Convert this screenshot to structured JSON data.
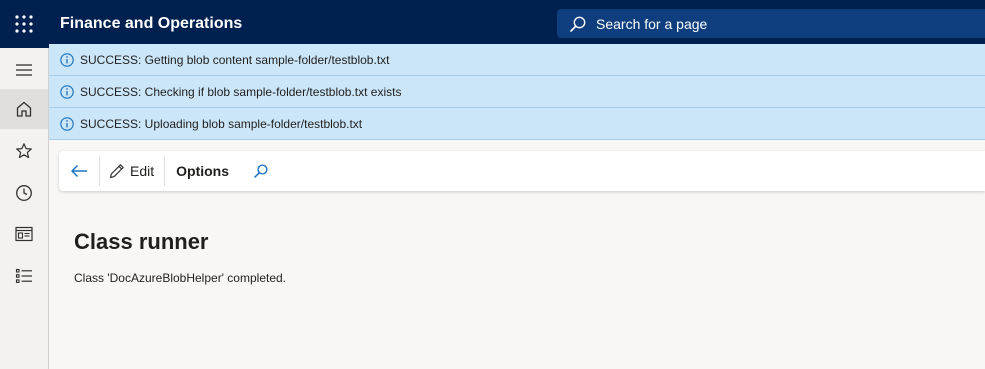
{
  "app": {
    "title": "Finance and Operations"
  },
  "search": {
    "placeholder": "Search for a page"
  },
  "nav": {
    "items": [
      {
        "name": "menu",
        "icon": "hamburger-icon"
      },
      {
        "name": "home",
        "icon": "home-icon"
      },
      {
        "name": "favorites",
        "icon": "star-icon"
      },
      {
        "name": "recent",
        "icon": "clock-icon"
      },
      {
        "name": "workspaces",
        "icon": "workspace-icon"
      },
      {
        "name": "modules",
        "icon": "list-icon"
      }
    ]
  },
  "messages": [
    {
      "text": "SUCCESS: Getting blob content sample-folder/testblob.txt",
      "icon": "info-icon"
    },
    {
      "text": "SUCCESS: Checking if blob sample-folder/testblob.txt exists",
      "icon": "info-icon"
    },
    {
      "text": "SUCCESS: Uploading blob sample-folder/testblob.txt",
      "icon": "info-icon"
    }
  ],
  "actionpane": {
    "edit_label": "Edit",
    "options_label": "Options"
  },
  "page": {
    "title": "Class runner",
    "body": "Class 'DocAzureBlobHelper' completed."
  },
  "colors": {
    "topbar": "#002050",
    "accent": "#0f6cbd",
    "message_bg": "#cce6f9"
  }
}
